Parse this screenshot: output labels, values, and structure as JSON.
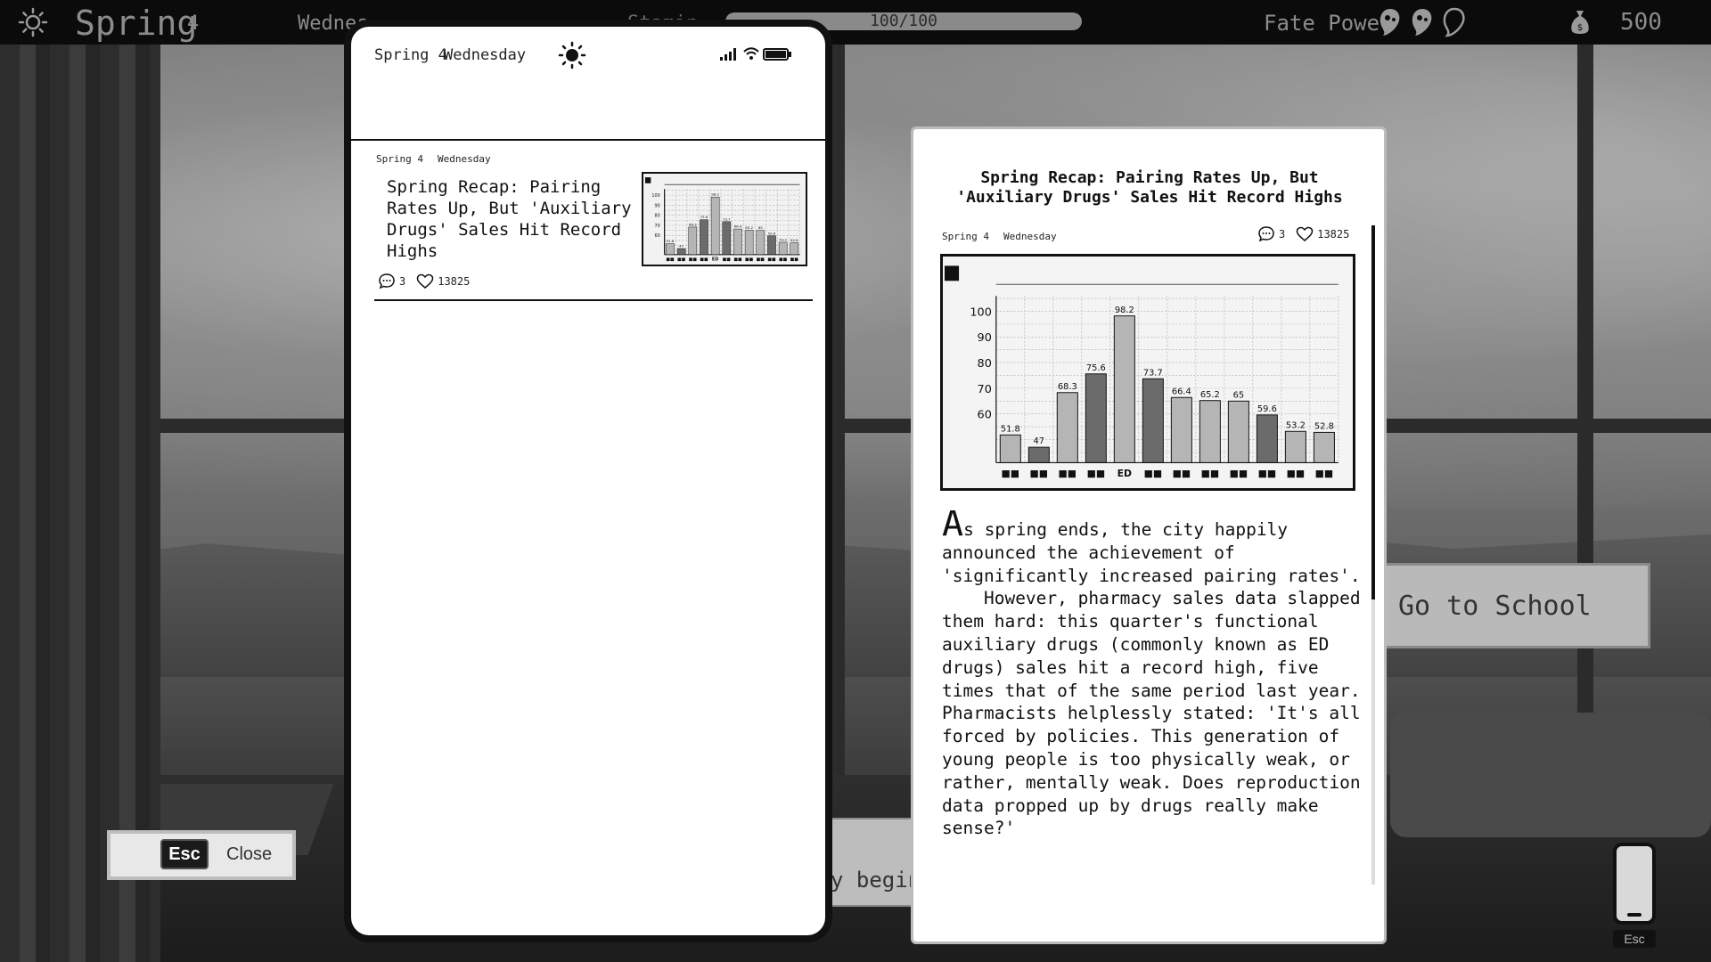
{
  "hud": {
    "season": "Spring",
    "season_day": "4",
    "weekday": "Wednes",
    "stamina_label": "Stamin",
    "stamina_text": "100/100",
    "stamina_fraction": 1.0,
    "fate_label": "Fate Power",
    "money": "500"
  },
  "background": {
    "go_school": "Go to School",
    "dialog_text": "y begins"
  },
  "esc_close": {
    "key": "Esc",
    "label": "Close"
  },
  "phone_button": {
    "esc": "Esc"
  },
  "phone": {
    "status_date": "Spring 4",
    "status_weekday": "Wednesday",
    "feed": [
      {
        "date": "Spring 4",
        "weekday": "Wednesday",
        "title": "Spring Recap: Pairing Rates Up, But 'Auxiliary Drugs' Sales Hit Record Highs",
        "comments": "3",
        "likes": "13825"
      }
    ]
  },
  "article": {
    "title": "Spring Recap: Pairing Rates Up, But 'Auxiliary Drugs' Sales Hit Record Highs",
    "date": "Spring 4",
    "weekday": "Wednesday",
    "comments": "3",
    "likes": "13825",
    "drop_cap": "A",
    "body": "s spring ends, the city happily announced the achievement of 'significantly increased pairing rates'.\n    However, pharmacy sales data slapped them hard: this quarter's functional auxiliary drugs (commonly known as ED drugs) sales hit a record high, five times that of the same period last year. Pharmacists helplessly stated: 'It's all forced by policies. This generation of young people is too physically weak, or rather, mentally weak. Does reproduction data propped up by drugs really make sense?'"
  },
  "chart_data": {
    "type": "bar",
    "categories": [
      "■■",
      "■■",
      "■■",
      "■■",
      "ED",
      "■■",
      "■■",
      "■■",
      "■■",
      "■■",
      "■■",
      "■■"
    ],
    "values": [
      51.8,
      47,
      68.3,
      75.6,
      98.2,
      73.7,
      66.4,
      65.2,
      65,
      59.6,
      53.2,
      52.8
    ],
    "value_labels": [
      "51.8",
      "47",
      "68.3",
      "75.6",
      "98.2",
      "73.7",
      "66.4",
      "65.2",
      "65",
      "59.6",
      "53.2",
      "52.8"
    ],
    "yticks": [
      60,
      70,
      80,
      90,
      100
    ],
    "ylim": [
      41,
      106
    ],
    "grid": true,
    "bar_shades": [
      "#b5b5b5",
      "#6b6b6b",
      "#b5b5b5",
      "#6b6b6b",
      "#b5b5b5",
      "#6b6b6b",
      "#b5b5b5",
      "#b5b5b5",
      "#b5b5b5",
      "#6b6b6b",
      "#b5b5b5",
      "#b5b5b5"
    ]
  },
  "icons": {
    "sun": "sun-icon",
    "fate": [
      "fate-orb-icon",
      "fate-orb-icon",
      "fate-orb-empty-icon"
    ],
    "money": "money-bag-icon",
    "comment": "comment-bubble-icon",
    "like": "heart-icon"
  }
}
